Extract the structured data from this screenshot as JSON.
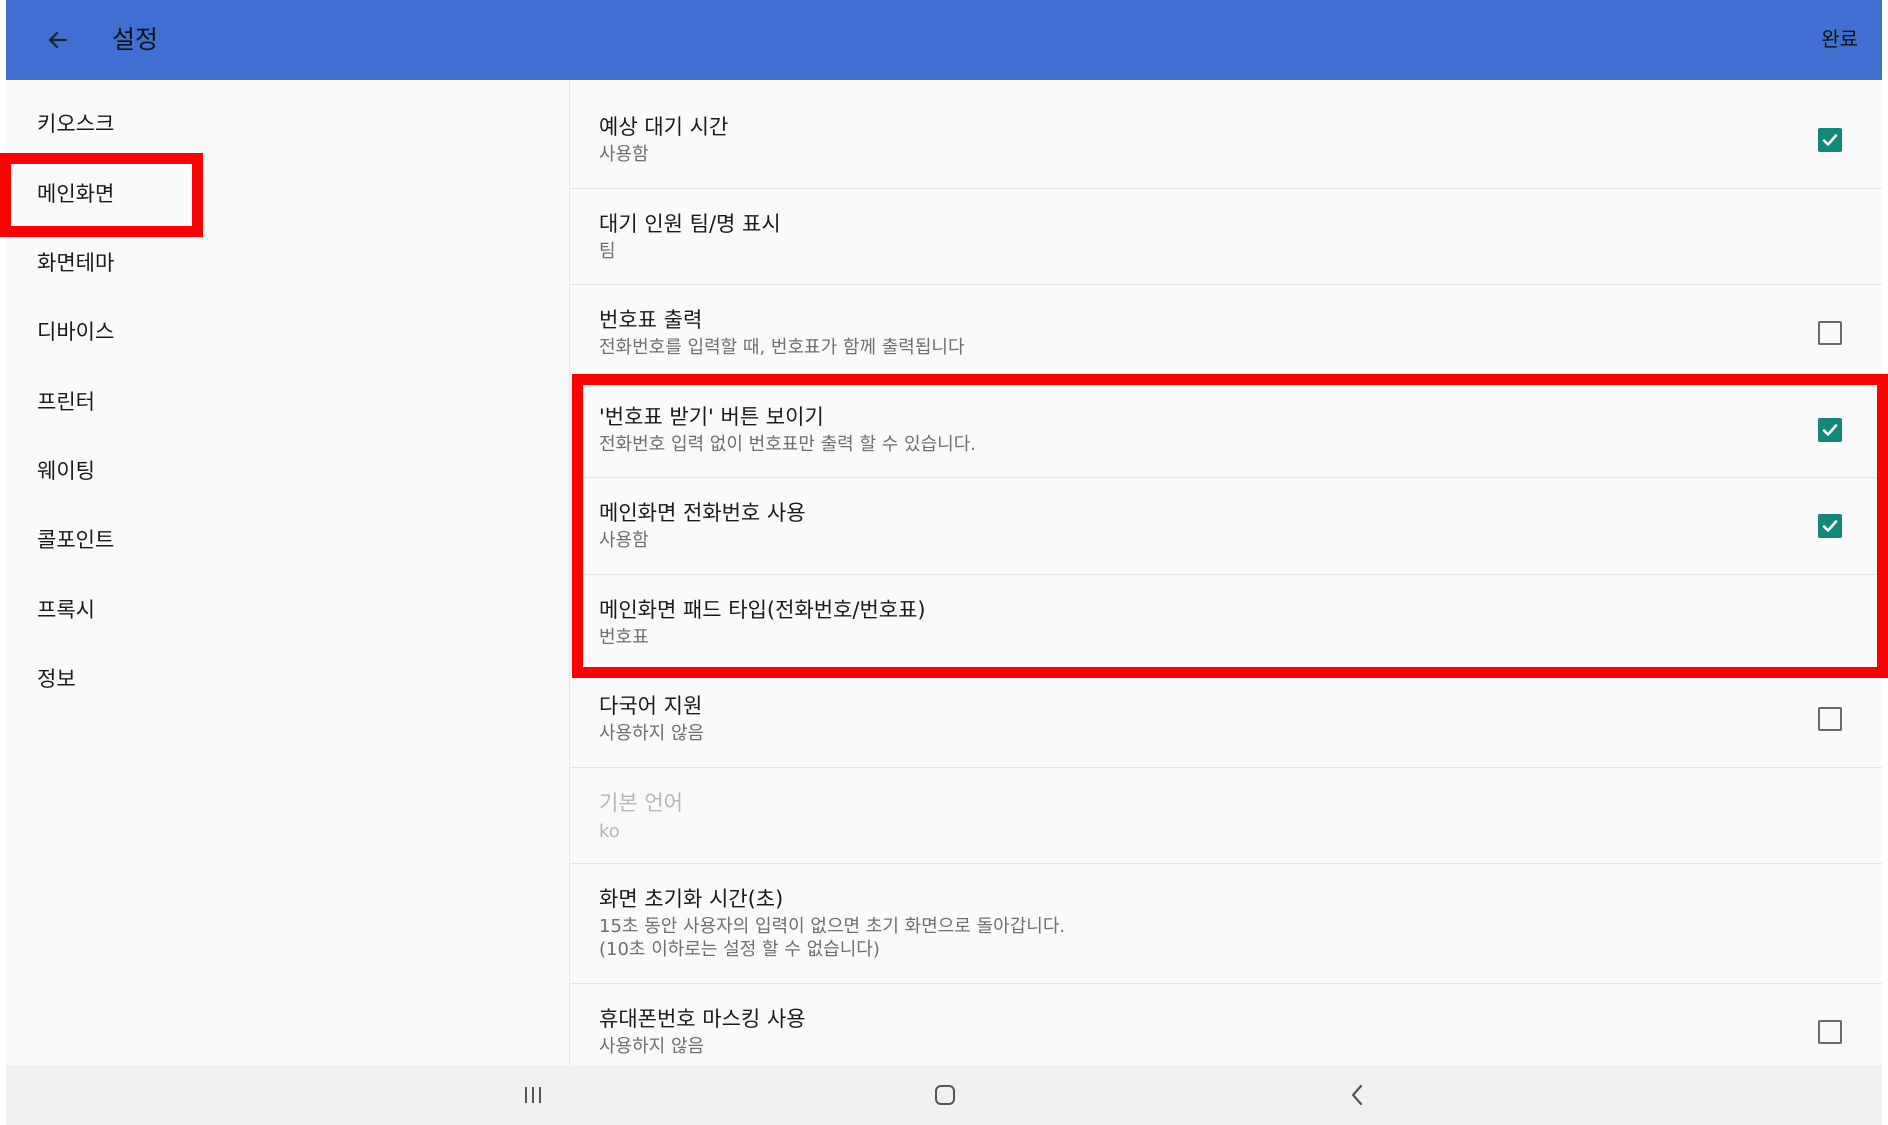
{
  "appbar": {
    "title": "설정",
    "done_label": "완료",
    "back_icon": "arrow-left-icon",
    "color": "#3e6fd1"
  },
  "sidebar": {
    "items": [
      {
        "label": "키오스크"
      },
      {
        "label": "메인화면"
      },
      {
        "label": "화면테마"
      },
      {
        "label": "디바이스"
      },
      {
        "label": "프린터"
      },
      {
        "label": "웨이팅"
      },
      {
        "label": "콜포인트"
      },
      {
        "label": "프록시"
      },
      {
        "label": "정보"
      }
    ]
  },
  "settings": {
    "items": [
      {
        "title": "예상 대기 시간",
        "summary": "사용함",
        "checked": true
      },
      {
        "title": "대기 인원 팀/명 표시",
        "summary": "팀"
      },
      {
        "title": "번호표 출력",
        "summary": "전화번호를 입력할 때, 번호표가 함께 출력됩니다",
        "checked": false
      },
      {
        "title": "'번호표 받기' 버튼 보이기",
        "summary": "전화번호 입력 없이 번호표만 출력 할 수 있습니다.",
        "checked": true
      },
      {
        "title": "메인화면 전화번호 사용",
        "summary": "사용함",
        "checked": true
      },
      {
        "title": "메인화면 패드 타입(전화번호/번호표)",
        "summary": "번호표"
      },
      {
        "title": "다국어 지원",
        "summary": "사용하지 않음",
        "checked": false
      },
      {
        "title": "기본 언어",
        "summary": "ko",
        "disabled": true
      },
      {
        "title": "화면 초기화 시간(초)",
        "summary_line1": "15초 동안 사용자의 입력이 없으면 초기 화면으로 돌아갑니다.",
        "summary_line2": "(10초 이하로는 설정 할 수 없습니다)"
      },
      {
        "title": "휴대폰번호 마스킹 사용",
        "summary": "사용하지 않음",
        "checked": false
      }
    ]
  },
  "colors": {
    "checkbox_on": "#0f8a7a",
    "highlight": "#ff0000"
  },
  "navbar": {
    "icons": [
      "recent-apps-icon",
      "home-icon",
      "back-icon"
    ]
  }
}
